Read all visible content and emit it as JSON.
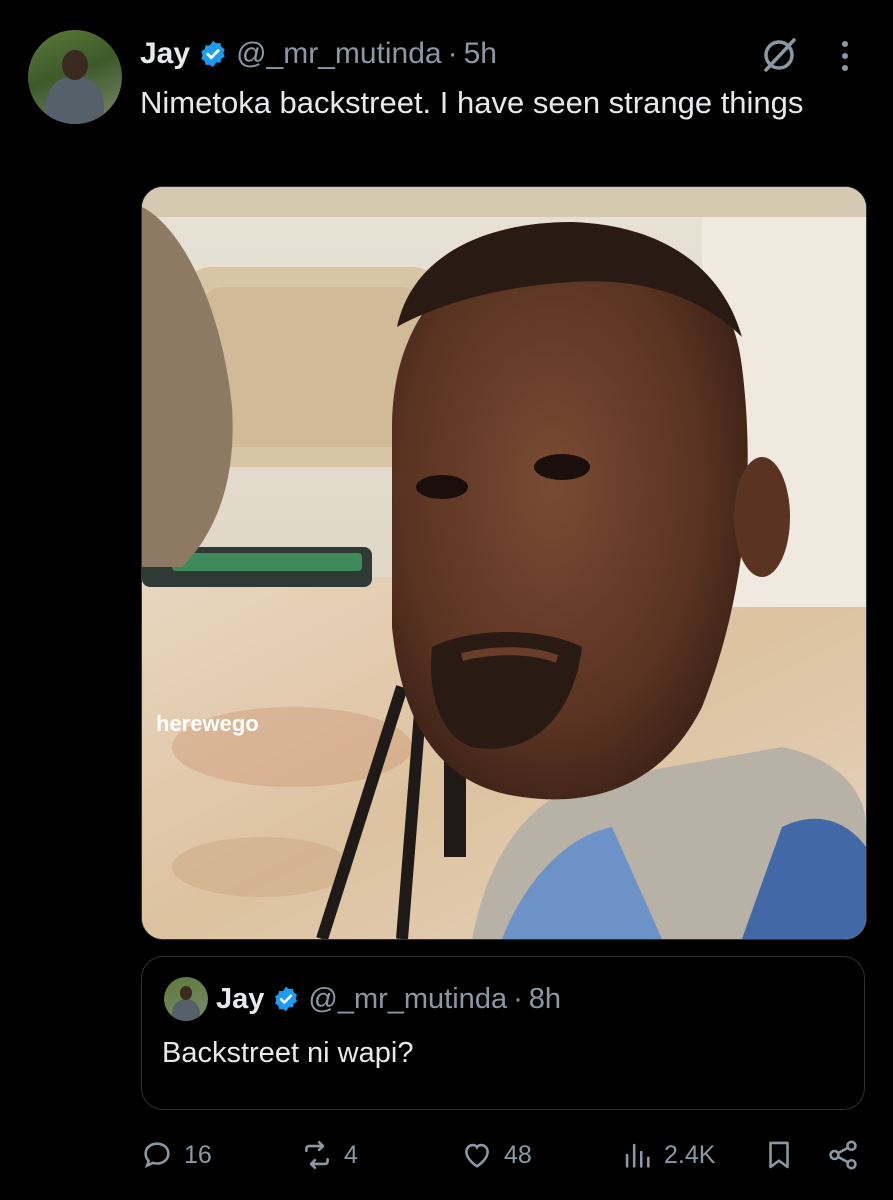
{
  "tweet": {
    "author_name": "Jay",
    "handle": "@_mr_mutinda",
    "separator": "·",
    "time": "5h",
    "text": "Nimetoka backstreet. I have seen strange things",
    "media_watermark": "herewego"
  },
  "quoted_tweet": {
    "author_name": "Jay",
    "handle": "@_mr_mutinda",
    "separator": "·",
    "time": "8h",
    "text": "Backstreet ni wapi?"
  },
  "actions": {
    "replies": "16",
    "reposts": "4",
    "likes": "48",
    "views": "2.4K"
  },
  "colors": {
    "background": "#000000",
    "text_primary": "#e7e9ea",
    "text_secondary": "#8b98a5",
    "verified_blue": "#1d9bf0",
    "border": "#2f3336"
  },
  "icons": [
    "verified-badge-icon",
    "grok-icon",
    "more-icon",
    "reply-icon",
    "repost-icon",
    "like-icon",
    "views-icon",
    "bookmark-icon",
    "share-icon"
  ]
}
